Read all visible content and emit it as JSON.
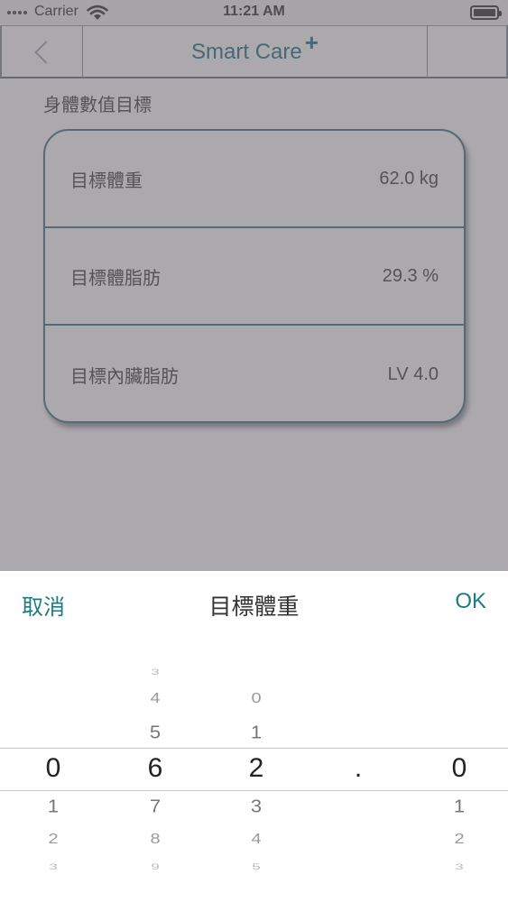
{
  "status_bar": {
    "carrier": "Carrier",
    "time": "11:21 AM"
  },
  "nav": {
    "title": "Smart Care",
    "title_suffix": "+"
  },
  "content": {
    "section_title": "身體數值目標",
    "rows": [
      {
        "label": "目標體重",
        "value": "62.0 kg"
      },
      {
        "label": "目標體脂肪",
        "value": "29.3 %"
      },
      {
        "label": "目標內臟脂肪",
        "value": "LV 4.0"
      }
    ]
  },
  "picker": {
    "cancel_label": "取消",
    "title": "目標體重",
    "ok_label": "OK",
    "decimal_separator": ".",
    "columns": [
      {
        "above": [
          "",
          "",
          ""
        ],
        "selected": "0",
        "below": [
          "1",
          "2",
          "3"
        ]
      },
      {
        "above": [
          "3",
          "4",
          "5"
        ],
        "selected": "6",
        "below": [
          "7",
          "8",
          "9"
        ]
      },
      {
        "above": [
          "",
          "0",
          "1"
        ],
        "selected": "2",
        "below": [
          "3",
          "4",
          "5"
        ]
      },
      {
        "above": [
          "",
          "",
          ""
        ],
        "selected": "0",
        "below": [
          "1",
          "2",
          "3"
        ]
      }
    ]
  },
  "colors": {
    "accent": "#1a7b85",
    "card_border": "#2f6f78",
    "overlay": "#6e6973"
  }
}
